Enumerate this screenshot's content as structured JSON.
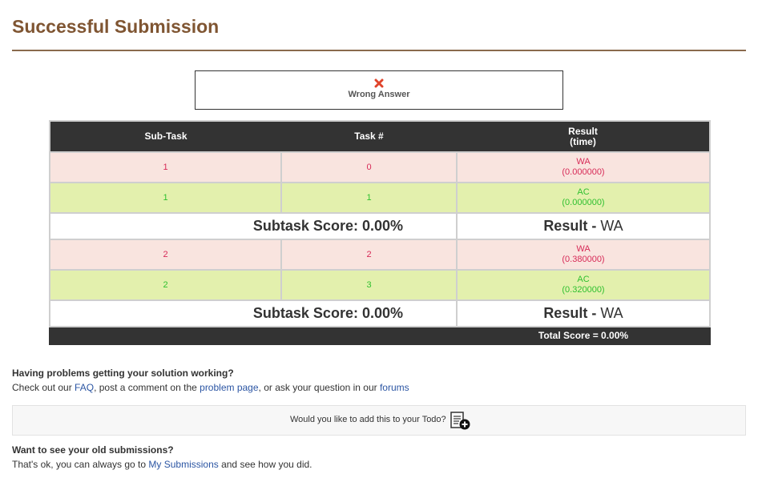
{
  "page": {
    "title": "Successful Submission"
  },
  "verdict": {
    "icon": "error-x-icon",
    "label": "Wrong Answer",
    "icon_color": "#e0442b"
  },
  "table": {
    "headers": {
      "subtask": "Sub-Task",
      "task": "Task #",
      "result_line1": "Result",
      "result_line2": "(time)"
    },
    "rows": [
      {
        "subtask": "1",
        "task": "0",
        "status": "WA",
        "time": "(0.000000)"
      },
      {
        "subtask": "1",
        "task": "1",
        "status": "AC",
        "time": "(0.000000)"
      },
      {
        "subtask": "2",
        "task": "2",
        "status": "WA",
        "time": "(0.380000)"
      },
      {
        "subtask": "2",
        "task": "3",
        "status": "AC",
        "time": "(0.320000)"
      }
    ],
    "subtask_scores": [
      {
        "score": "Subtask Score: 0.00%",
        "result_label": "Result -",
        "result_value": "WA"
      },
      {
        "score": "Subtask Score: 0.00%",
        "result_label": "Result -",
        "result_value": "WA"
      }
    ],
    "total": "Total Score = 0.00%"
  },
  "help": {
    "heading": "Having problems getting your solution working?",
    "prefix": "Check out our ",
    "faq_link": "FAQ",
    "middle1": ", post a comment on the ",
    "problem_link": "problem page",
    "middle2": ", or ask your question in our ",
    "forums_link": "forums"
  },
  "todo": {
    "text": "Would you like to add this to your Todo?",
    "icon": "add-todo-icon"
  },
  "old": {
    "heading": "Want to see your old submissions?",
    "prefix": "That's ok, you can always go to ",
    "link": "My Submissions",
    "suffix": " and see how you did."
  },
  "colors": {
    "title": "#7f5532",
    "wa_bg": "#f9e4df",
    "wa_text": "#d72a57",
    "ac_bg": "#e3f0ad",
    "ac_text": "#2fc02f",
    "header_bg": "#333333",
    "link": "#2b55a3"
  }
}
